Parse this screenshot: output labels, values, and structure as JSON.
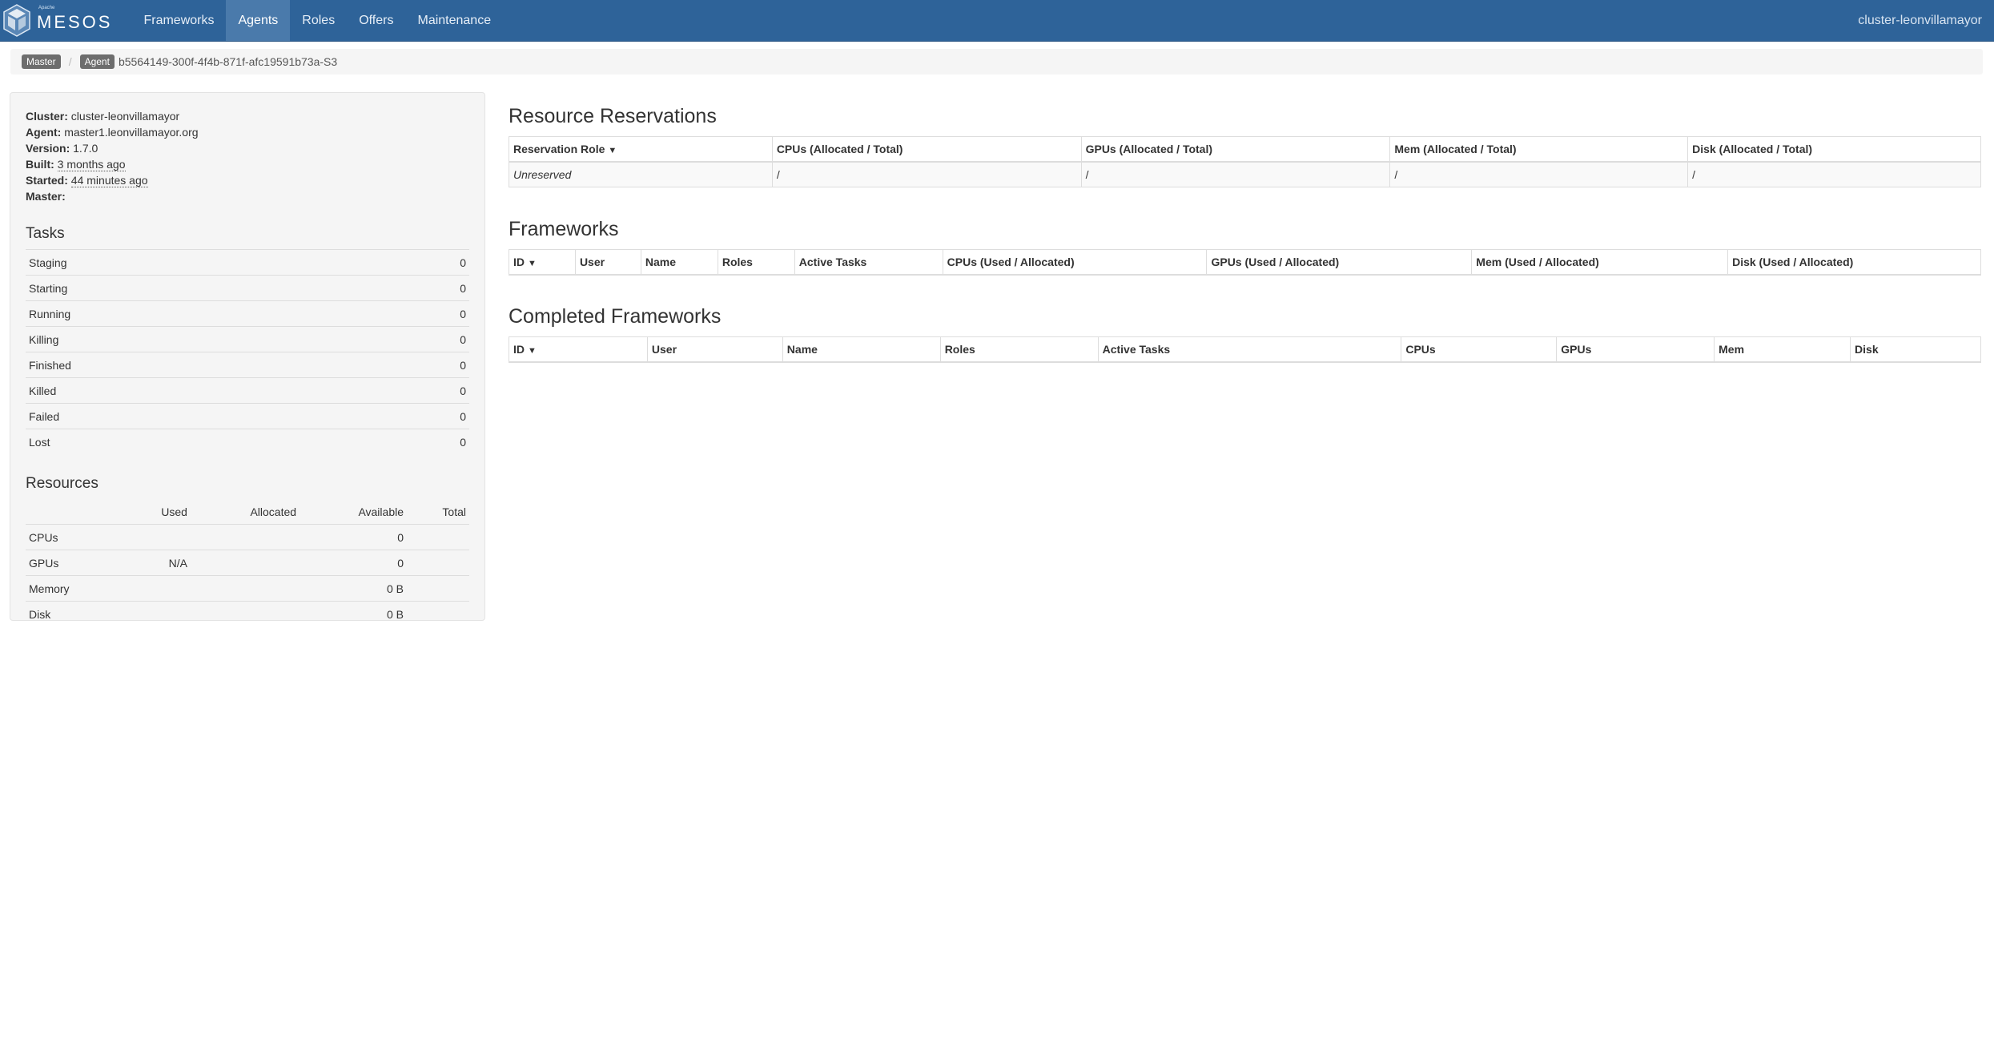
{
  "nav": {
    "brand": "MESOS",
    "brand_sub": "Apache",
    "items": [
      {
        "label": "Frameworks",
        "active": false
      },
      {
        "label": "Agents",
        "active": true
      },
      {
        "label": "Roles",
        "active": false
      },
      {
        "label": "Offers",
        "active": false
      },
      {
        "label": "Maintenance",
        "active": false
      }
    ],
    "cluster": "cluster-leonvillamayor"
  },
  "breadcrumb": {
    "master_label": "Master",
    "separator": "/",
    "agent_label": "Agent",
    "agent_id": "b5564149-300f-4f4b-871f-afc19591b73a-S3"
  },
  "agent_info": {
    "cluster_label": "Cluster:",
    "cluster": "cluster-leonvillamayor",
    "agent_label": "Agent:",
    "agent": "master1.leonvillamayor.org",
    "version_label": "Version:",
    "version": "1.7.0",
    "built_label": "Built:",
    "built": "3 months ago",
    "started_label": "Started:",
    "started": "44 minutes ago",
    "master_label": "Master:",
    "master": ""
  },
  "tasks": {
    "title": "Tasks",
    "rows": [
      {
        "label": "Staging",
        "value": "0"
      },
      {
        "label": "Starting",
        "value": "0"
      },
      {
        "label": "Running",
        "value": "0"
      },
      {
        "label": "Killing",
        "value": "0"
      },
      {
        "label": "Finished",
        "value": "0"
      },
      {
        "label": "Killed",
        "value": "0"
      },
      {
        "label": "Failed",
        "value": "0"
      },
      {
        "label": "Lost",
        "value": "0"
      }
    ]
  },
  "resources": {
    "title": "Resources",
    "headers": [
      "Used",
      "Allocated",
      "Available",
      "Total"
    ],
    "rows": [
      {
        "label": "CPUs",
        "used": "",
        "allocated": "",
        "available": "0",
        "total": ""
      },
      {
        "label": "GPUs",
        "used": "N/A",
        "allocated": "",
        "available": "0",
        "total": ""
      },
      {
        "label": "Memory",
        "used": "",
        "allocated": "",
        "available": "0 B",
        "total": ""
      },
      {
        "label": "Disk",
        "used": "",
        "allocated": "",
        "available": "0 B",
        "total": ""
      }
    ]
  },
  "reservations": {
    "title": "Resource Reservations",
    "headers": [
      "Reservation Role",
      "CPUs (Allocated / Total)",
      "GPUs (Allocated / Total)",
      "Mem (Allocated / Total)",
      "Disk (Allocated / Total)"
    ],
    "sort_caret": "▼",
    "row": [
      "Unreserved",
      "/",
      "/",
      "/",
      "/"
    ]
  },
  "frameworks": {
    "title": "Frameworks",
    "headers": [
      "ID",
      "User",
      "Name",
      "Roles",
      "Active Tasks",
      "CPUs (Used / Allocated)",
      "GPUs (Used / Allocated)",
      "Mem (Used / Allocated)",
      "Disk (Used / Allocated)"
    ],
    "sort_caret": "▼"
  },
  "completed_frameworks": {
    "title": "Completed Frameworks",
    "headers": [
      "ID",
      "User",
      "Name",
      "Roles",
      "Active Tasks",
      "CPUs",
      "GPUs",
      "Mem",
      "Disk"
    ],
    "sort_caret": "▼"
  },
  "colors": {
    "navbar": "#2e6399",
    "nav_active": "#4a7aab",
    "label": "#6d6d6d"
  }
}
